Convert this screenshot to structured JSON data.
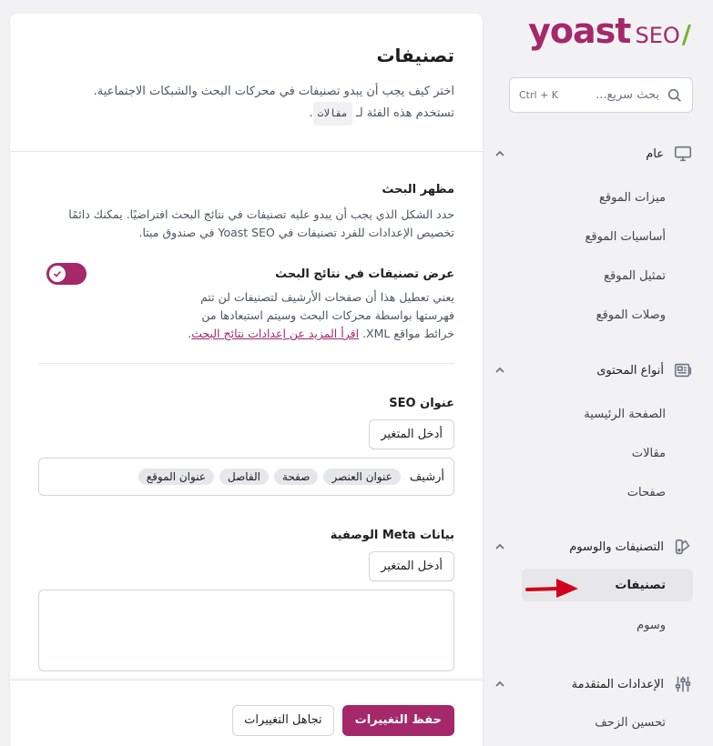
{
  "brand": {
    "logo_main": "yoast",
    "logo_seo": "SEO",
    "logo_slash": "/"
  },
  "search": {
    "placeholder": "بحث سريع...",
    "shortcut": "Ctrl + K"
  },
  "sidebar": {
    "groups": [
      {
        "label": "عام",
        "icon": "desktop-icon",
        "items": [
          {
            "label": "ميزات الموقع"
          },
          {
            "label": "أساسيات الموقع"
          },
          {
            "label": "تمثيل الموقع"
          },
          {
            "label": "وصلات الموقع"
          }
        ]
      },
      {
        "label": "أنواع المحتوى",
        "icon": "newspaper-icon",
        "items": [
          {
            "label": "الصفحة الرئيسية"
          },
          {
            "label": "مقالات"
          },
          {
            "label": "صفحات"
          }
        ]
      },
      {
        "label": "التصنيفات والوسوم",
        "icon": "color-swatch-icon",
        "items": [
          {
            "label": "تصنيفات",
            "active": true
          },
          {
            "label": "وسوم"
          }
        ]
      },
      {
        "label": "الإعدادات المتقدمة",
        "icon": "adjustments-icon",
        "items": [
          {
            "label": "تحسين الزحف"
          }
        ]
      }
    ]
  },
  "main": {
    "title": "تصنيفات",
    "desc_line1": "اختر كيف يجب أن يبدو تصنيفات في محركات البحث والشبكات الاجتماعية.",
    "desc_line2_prefix": "تستخدم هذه الفئة لـ",
    "desc_code": "مقالات",
    "desc_line2_suffix": ".",
    "search_appearance": {
      "title": "مظهر البحث",
      "desc": "حدد الشكل الذي يجب أن يبدو عليه تصنيفات في نتائج البحث افتراضيًا. يمكنك دائمًا تخصيص الإعدادات للفرد تصنيفات في Yoast SEO في صندوق ميتا."
    },
    "toggle": {
      "label": "عرض تصنيفات في نتائج البحث",
      "desc": "يعني تعطيل هذا أن صفحات الأرشيف لتصنيفات لن تتم فهرستها بواسطة محركات البحث وسيتم استبعادها من خرائط مواقع XML. ",
      "link": "اقرأ المزيد عن إعدادات نتائج البحث",
      "link_suffix": ".",
      "on": true
    },
    "seo_title": {
      "label": "عنوان SEO",
      "insert_var": "أدخل المتغير",
      "plain": "أرشيف",
      "tokens": [
        "عنوان العنصر",
        "صفحة",
        "الفاصل",
        "عنوان الموقع"
      ]
    },
    "meta_desc": {
      "label": "بيانات Meta الوصفية",
      "insert_var": "أدخل المتغير"
    }
  },
  "footer": {
    "save": "حفظ التغييرات",
    "discard": "تجاهل التغييرات"
  },
  "colors": {
    "brand": "#a4286a",
    "accent_green": "#77b227",
    "arrow": "#d0021b"
  }
}
